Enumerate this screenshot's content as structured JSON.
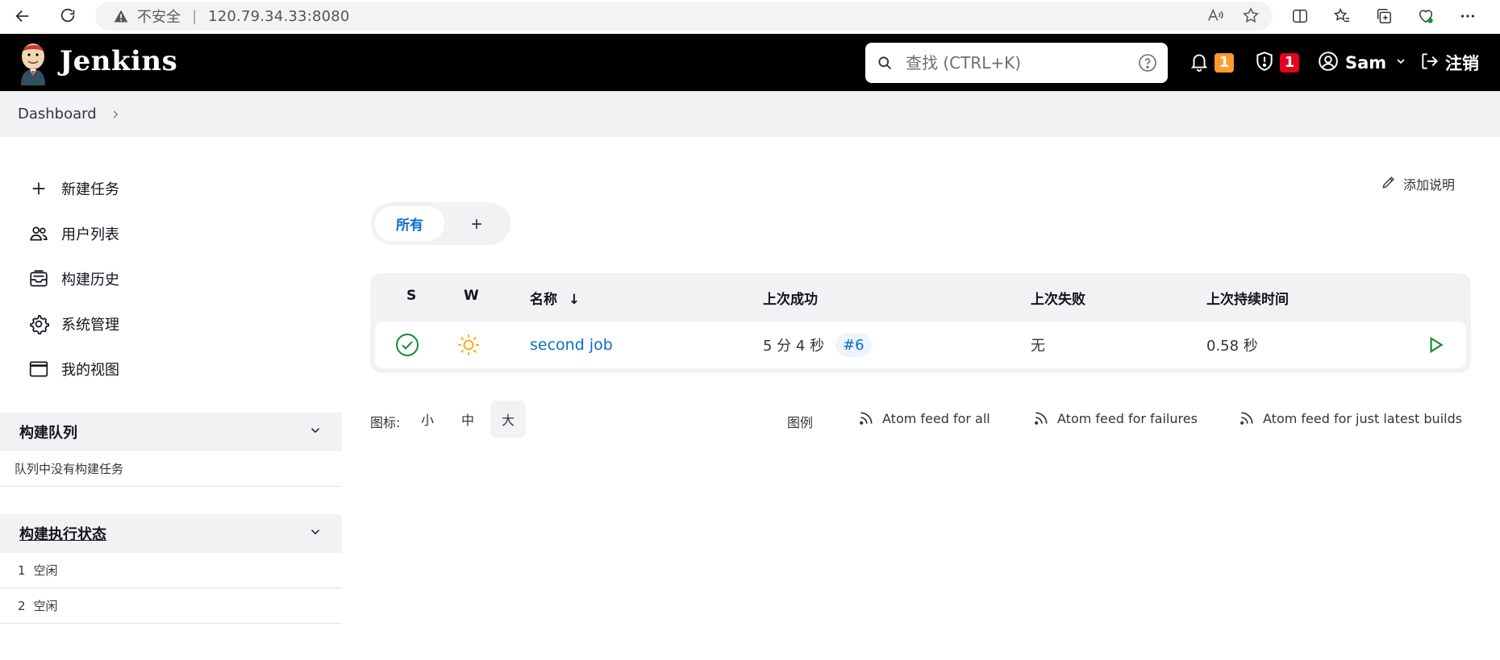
{
  "browser": {
    "insecure_label": "不安全",
    "separator": "|",
    "url": "120.79.34.33:8080"
  },
  "header": {
    "brand": "Jenkins",
    "search_placeholder": "查找 (CTRL+K)",
    "notifications_count": "1",
    "security_count": "1",
    "user_name": "Sam",
    "logout_label": "注销",
    "colors": {
      "bg": "#000000",
      "notify_badge": "#fe9c29",
      "security_badge": "#e6001f"
    }
  },
  "breadcrumb": {
    "items": [
      {
        "label": "Dashboard"
      }
    ]
  },
  "sidebar": {
    "tasks": [
      {
        "label": "新建任务",
        "icon": "plus-icon"
      },
      {
        "label": "用户列表",
        "icon": "people-icon"
      },
      {
        "label": "构建历史",
        "icon": "history-icon"
      },
      {
        "label": "系统管理",
        "icon": "gear-icon"
      },
      {
        "label": "我的视图",
        "icon": "window-icon"
      }
    ],
    "build_queue": {
      "title": "构建队列",
      "empty_text": "队列中没有构建任务"
    },
    "executors": {
      "title": "构建执行状态",
      "rows": [
        {
          "num": "1",
          "status": "空闲"
        },
        {
          "num": "2",
          "status": "空闲"
        }
      ]
    }
  },
  "main": {
    "add_description": "添加说明",
    "tabs": [
      {
        "label": "所有",
        "active": true
      }
    ],
    "table": {
      "headers": {
        "s": "S",
        "w": "W",
        "name": "名称",
        "sort_arrow": "↓",
        "last_success": "上次成功",
        "last_failure": "上次失败",
        "last_duration": "上次持续时间"
      },
      "rows": [
        {
          "status_icon": "success-check-icon",
          "weather_icon": "sunny-icon",
          "name": "second job",
          "last_success": "5 分 4 秒",
          "last_success_build": "#6",
          "last_failure": "无",
          "last_duration": "0.58 秒"
        }
      ]
    },
    "icon_size": {
      "label": "图标:",
      "small": "小",
      "medium": "中",
      "large": "大",
      "selected": "大"
    },
    "legend": "图例",
    "feeds": {
      "all": "Atom feed for all",
      "failures": "Atom feed for failures",
      "latest": "Atom feed for just latest builds"
    }
  }
}
